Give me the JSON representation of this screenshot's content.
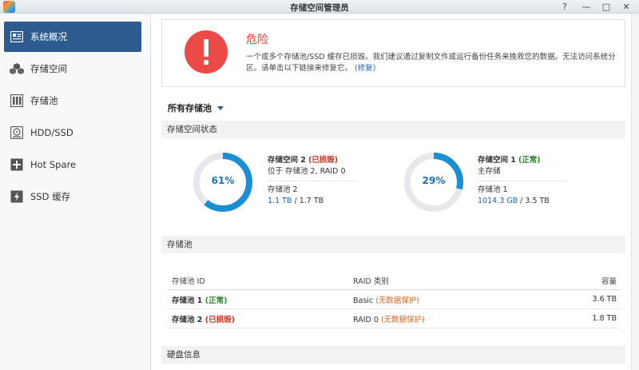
{
  "window": {
    "title": "存储空间管理员",
    "help": "?",
    "minimize": "—",
    "maximize": "□",
    "close": "✕"
  },
  "sidebar": {
    "items": [
      {
        "label": "系统概况",
        "icon": "overview-icon",
        "active": true
      },
      {
        "label": "存储空间",
        "icon": "volume-icon"
      },
      {
        "label": "存储池",
        "icon": "storage-pool-icon"
      },
      {
        "label": "HDD/SSD",
        "icon": "hdd-icon"
      },
      {
        "label": "Hot Spare",
        "icon": "hot-spare-icon"
      },
      {
        "label": "SSD 缓存",
        "icon": "ssd-cache-icon"
      }
    ]
  },
  "alert": {
    "title": "危险",
    "message": "一个或多个存储池/SSD 缓存已损毁。我们建议通过复制文件或运行备份任务来挽救您的数据。无法访问系统分区。请单击以下链接来修复它。",
    "link": "(修复)"
  },
  "pool_filter": {
    "label": "所有存储池"
  },
  "sections": {
    "volume_status": "存储空间状态",
    "storage_pool": "存储池",
    "disk_info": "硬盘信息"
  },
  "volumes": [
    {
      "name": "存储空间 2",
      "status": "(已损毁)",
      "status_type": "bad",
      "location": "位于 存储池 2, RAID 0",
      "pool": "存储池 2",
      "used": "1.1 TB",
      "total": " / 1.7 TB",
      "percent_label": "61%",
      "percent": 61
    },
    {
      "name": "存储空间 1",
      "status": "(正常)",
      "status_type": "ok",
      "location": "主存储",
      "pool": "存储池 1",
      "used": "1014.3 GB",
      "total": " / 3.5 TB",
      "percent_label": "29%",
      "percent": 29
    }
  ],
  "pool_table": {
    "headers": [
      "存储池 ID",
      "RAID 类别",
      "容量"
    ],
    "rows": [
      {
        "id": "存储池 1",
        "id_status": "(正常)",
        "raid": "Basic",
        "raid_note": "(无数据保护)",
        "capacity": "3.6 TB"
      },
      {
        "id": "存储池 2",
        "id_status": "(已损毁)",
        "raid": "RAID 0",
        "raid_note": "(无数据保护)",
        "capacity": "1.8 TB"
      }
    ]
  },
  "colors": {
    "accent": "#2e5b8f",
    "danger": "#ec4a46",
    "donut_fill": "#1a8fd6",
    "donut_track": "#e6e8eb"
  }
}
